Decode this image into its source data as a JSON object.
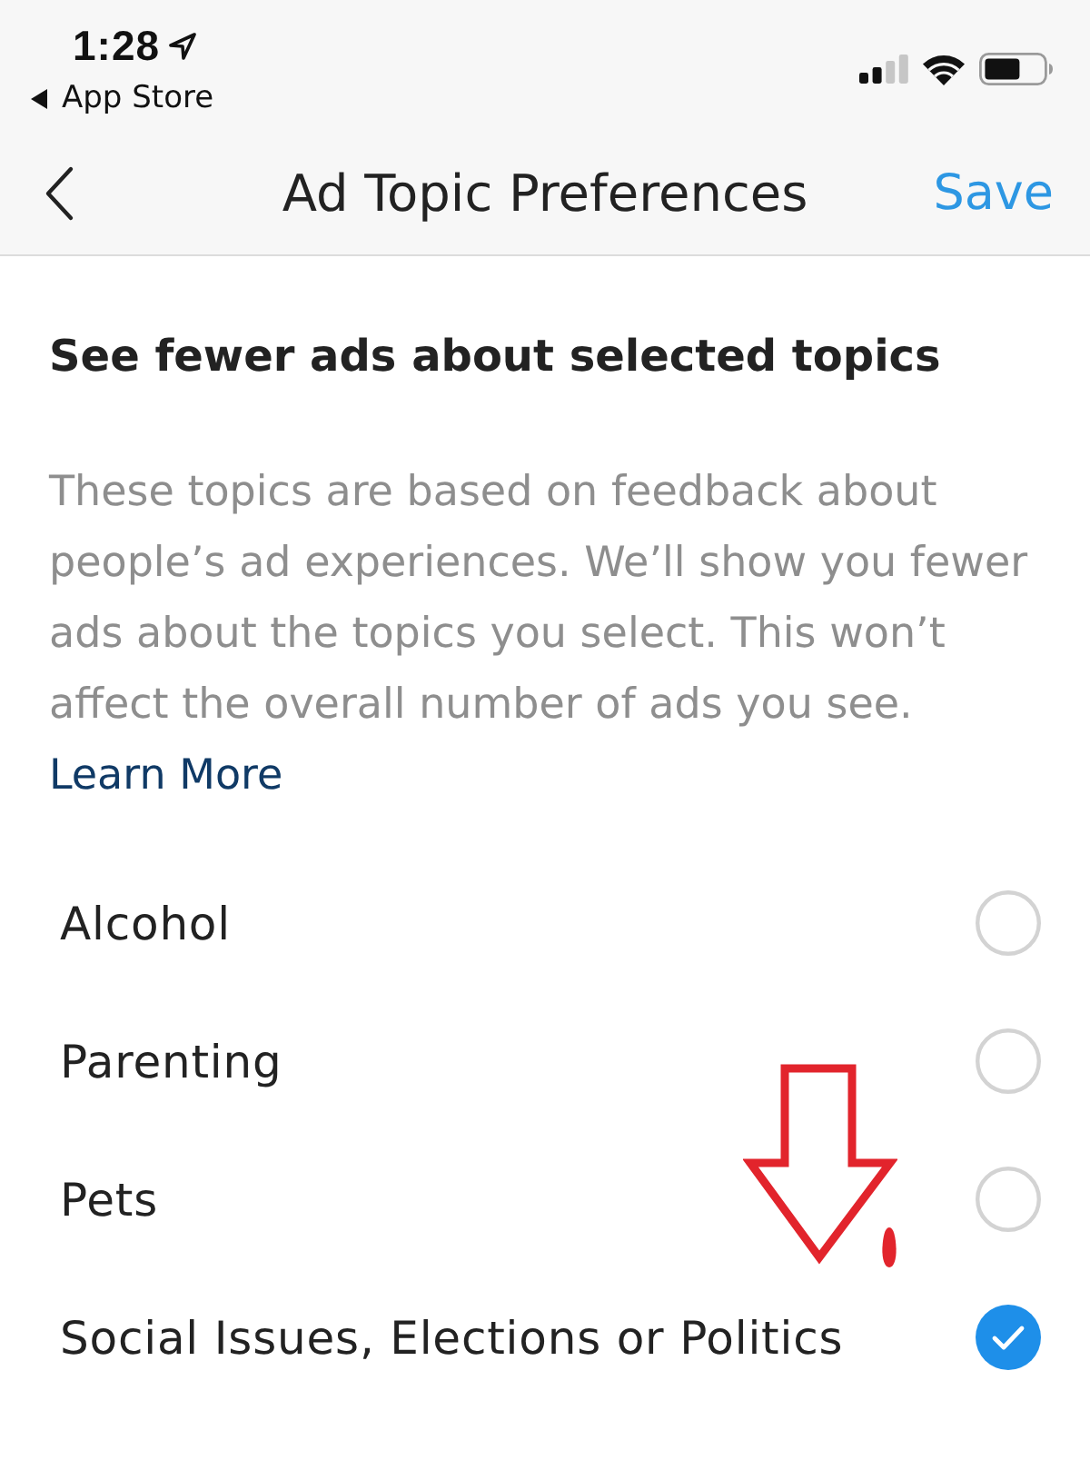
{
  "status_bar": {
    "time": "1:28",
    "back_link": "App Store"
  },
  "nav_bar": {
    "title": "Ad Topic Preferences",
    "action": "Save"
  },
  "section": {
    "heading": "See fewer ads about selected topics",
    "description": "These topics are based on feedback about people’s ad experiences. We’ll show you fewer ads about the topics you select. This won’t affect the overall number of ads you see.",
    "link": "Learn More"
  },
  "topics": [
    {
      "label": "Alcohol",
      "selected": false
    },
    {
      "label": "Parenting",
      "selected": false
    },
    {
      "label": "Pets",
      "selected": false
    },
    {
      "label": "Social Issues, Elections or Politics",
      "selected": true
    }
  ],
  "annotations": [
    {
      "kind": "arrow"
    },
    {
      "kind": "dot"
    }
  ]
}
